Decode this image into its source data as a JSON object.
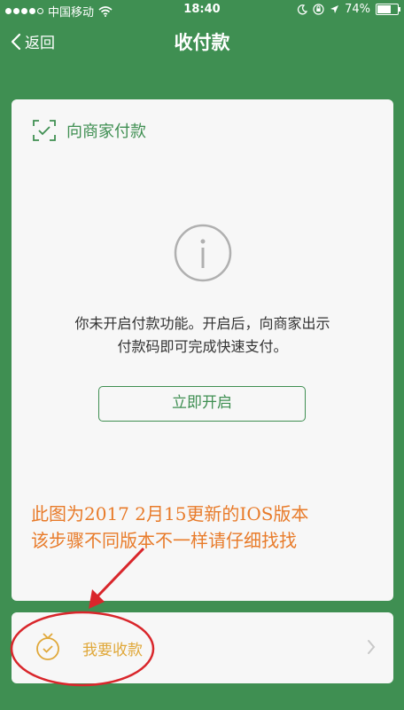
{
  "status_bar": {
    "carrier": "中国移动",
    "time": "18:40",
    "battery_percent": "74%",
    "battery_level": 0.74,
    "signal_icon": "signal-dots-icon",
    "wifi_icon": "wifi-icon"
  },
  "nav": {
    "back_label": "返回",
    "title": "收付款"
  },
  "pay_section": {
    "header_label": "向商家付款",
    "info_line1": "你未开启付款功能。开启后，向商家出示",
    "info_line2": "付款码即可完成快速支付。",
    "open_button_label": "立即开启"
  },
  "annotation": {
    "line1": "此图为2017 2月15更新的IOS版本",
    "line2": "该步骤不同版本不一样请仔细找找"
  },
  "receive_section": {
    "label": "我要收款"
  },
  "colors": {
    "primary_green": "#3f8f52",
    "annotation_orange": "#e87b2a",
    "receive_gold": "#e0a83a",
    "highlight_red": "#d9262b"
  }
}
